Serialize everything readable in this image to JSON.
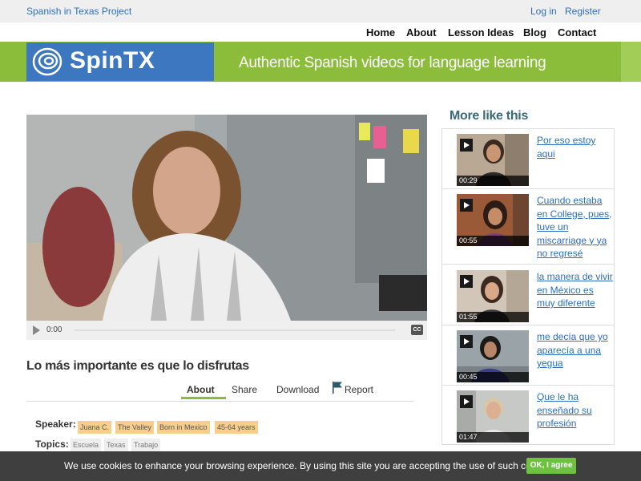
{
  "topbar": {
    "site_name": "Spanish in Texas Project",
    "login": "Log in",
    "register": "Register"
  },
  "nav": [
    "Home",
    "About",
    "Lesson Ideas",
    "Blog",
    "Contact"
  ],
  "banner": {
    "logo": "SpinTX",
    "tagline": "Authentic Spanish videos for language learning",
    "green": "#8cbd3a",
    "blue": "#3c77c0"
  },
  "player": {
    "time": "0:00",
    "cc": "CC"
  },
  "video": {
    "title": "Lo más importante es que lo disfrutas",
    "tabs": {
      "about": "About",
      "share": "Share",
      "download": "Download",
      "report": "Report"
    }
  },
  "meta": {
    "speaker_label": "Speaker:",
    "speaker_tags": [
      "Juana C.",
      "The Valley",
      "Born in Mexico",
      "45-64 years"
    ],
    "topics_label": "Topics:",
    "topic_tags": [
      "Escuela",
      "Texas",
      "Trabajo"
    ]
  },
  "sidebar": {
    "title": "More like this",
    "items": [
      {
        "title": "Por eso estoy aqui",
        "duration": "00:29"
      },
      {
        "title": "Cuando estaba en College, pues, tuve un miscarriage y ya no regresé",
        "duration": "00:55"
      },
      {
        "title": "la manera de vivir en México es muy diferente",
        "duration": "01:55"
      },
      {
        "title": "me decía que yo aparecía a una yegua",
        "duration": "00:45"
      },
      {
        "title": "Que le ha enseñado su profesión",
        "duration": "01:47"
      }
    ]
  },
  "cookie": {
    "text": "We use cookies to enhance your browsing experience. By using this site you are accepting the use of such cookies.",
    "button": "OK, I agree"
  }
}
